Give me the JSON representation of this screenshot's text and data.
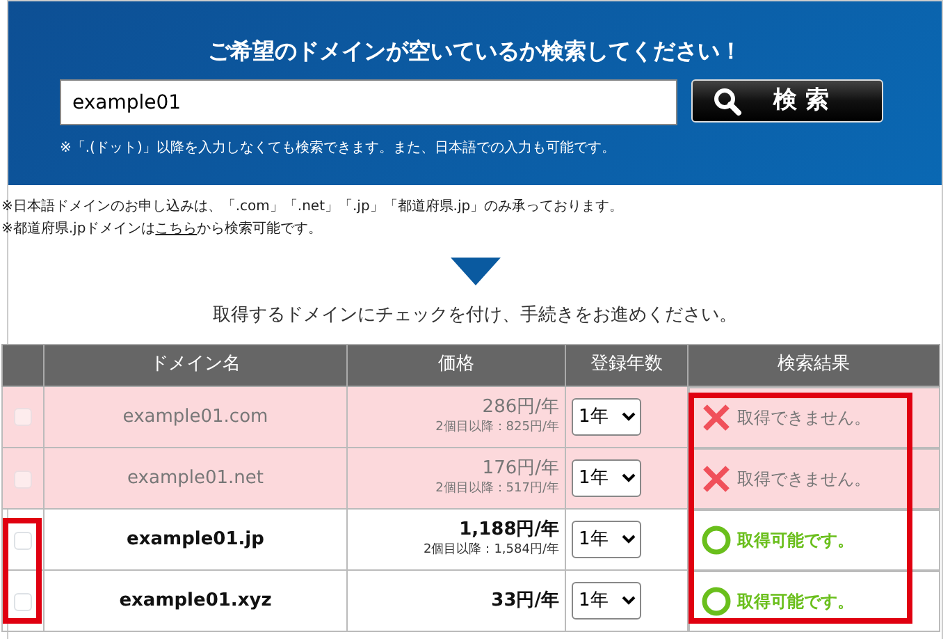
{
  "search": {
    "title": "ご希望のドメインが空いているか検索してください！",
    "value": "example01",
    "button": "検 索",
    "note": "※「.(ドット)」以降を入力しなくても検索できます。また、日本語での入力も可能です。"
  },
  "notices": [
    {
      "before": "※日本語ドメインのお申し込みは、「.com」「.net」「.jp」「都道府県.jp」のみ承っております。"
    },
    {
      "before": "※都道府県.jpドメインは",
      "link": "こちら",
      "after": "から検索可能です。"
    }
  ],
  "instruction": "取得するドメインにチェックを付け、手続きをお進めください。",
  "table": {
    "columns": [
      "ドメイン名",
      "価格",
      "登録年数",
      "検索結果"
    ],
    "result_frame": true,
    "rows": [
      {
        "available": false,
        "checked": false,
        "highlight_checkbox": false,
        "domain": "example01.com",
        "price": "286円/年",
        "price_note": "2個目以降：825円/年",
        "years": "1年",
        "result": "取得できません。"
      },
      {
        "available": false,
        "checked": false,
        "highlight_checkbox": false,
        "domain": "example01.net",
        "price": "176円/年",
        "price_note": "2個目以降：517円/年",
        "years": "1年",
        "result": "取得できません。"
      },
      {
        "available": true,
        "checked": false,
        "highlight_checkbox": true,
        "domain": "example01.jp",
        "price": "1,188円/年",
        "price_note": "2個目以降：1,584円/年",
        "years": "1年",
        "result": "取得可能です。"
      },
      {
        "available": true,
        "checked": false,
        "highlight_checkbox": true,
        "domain": "example01.xyz",
        "price": "33円/年",
        "years": "1年",
        "result": "取得可能です。"
      }
    ]
  }
}
